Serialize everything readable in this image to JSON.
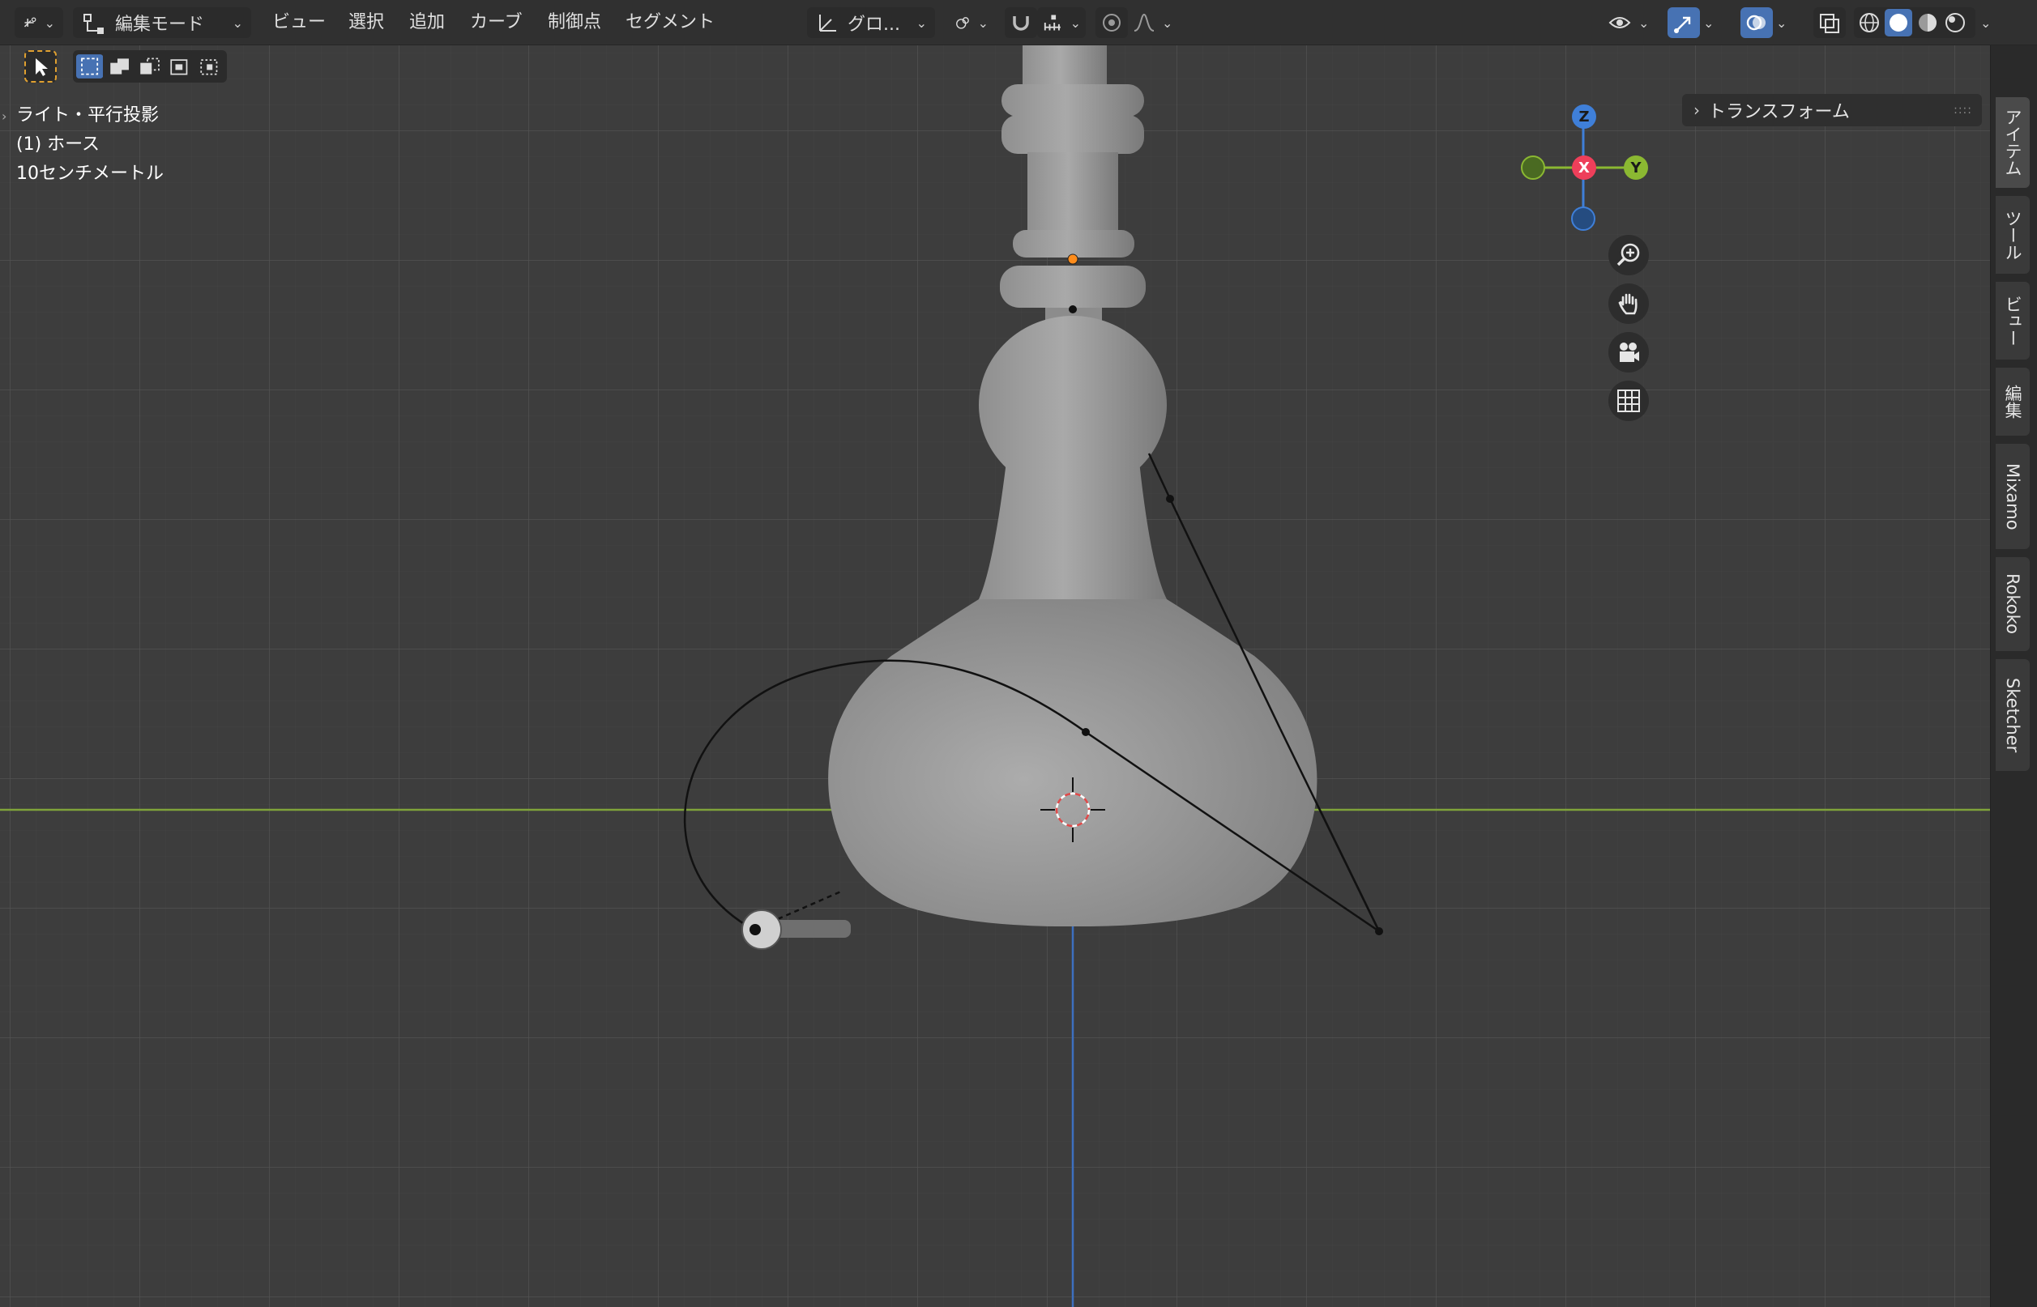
{
  "header": {
    "mode_label": "編集モード",
    "menus": [
      "ビュー",
      "選択",
      "追加",
      "カーブ",
      "制御点",
      "セグメント"
    ],
    "transform_orientation": "グロ..."
  },
  "viewport_info": {
    "view_name": "ライト・平行投影",
    "object_name": "(1) ホース",
    "scale": "10センチメートル"
  },
  "gizmo": {
    "z": "Z",
    "x": "X",
    "y": "Y"
  },
  "transform_panel": {
    "label": "トランスフォーム"
  },
  "sidebar_tabs": [
    "アイテム",
    "ツール",
    "ビュー",
    "編集",
    "Mixamo",
    "Rokoko",
    "Sketcher"
  ],
  "colors": {
    "header": "#303030",
    "viewport": "#3d3d3d",
    "grid_line": "#4a4a4a",
    "x_axis_line": "#7fa33a",
    "z_axis_line": "#3d6fbf",
    "accent": "#4772b3",
    "gizmo_x": "#ee3f5a",
    "gizmo_y": "#8bb832",
    "gizmo_z": "#3f7fd8"
  }
}
